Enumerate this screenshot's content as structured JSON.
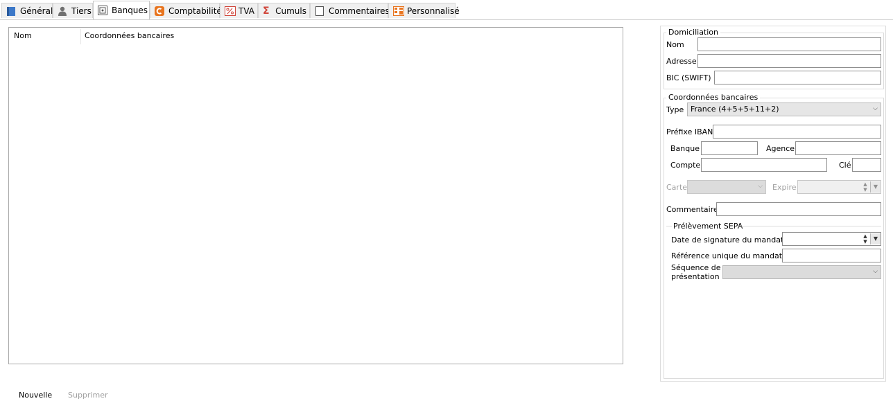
{
  "tabs": [
    {
      "label": "Général",
      "icon": "general-icon"
    },
    {
      "label": "Tiers",
      "icon": "person-icon"
    },
    {
      "label": "Banques",
      "icon": "bank-icon"
    },
    {
      "label": "Comptabilité",
      "icon": "accounting-icon"
    },
    {
      "label": "TVA",
      "icon": "percent-icon"
    },
    {
      "label": "Cumuls",
      "icon": "sigma-icon"
    },
    {
      "label": "Commentaires",
      "icon": "note-icon"
    },
    {
      "label": "Personnalisé",
      "icon": "custom-icon"
    }
  ],
  "list": {
    "columns": [
      "Nom",
      "Coordonnées bancaires"
    ]
  },
  "domiciliation": {
    "title": "Domiciliation",
    "nom_label": "Nom",
    "adresse_label": "Adresse",
    "bic_label": "BIC (SWIFT)",
    "nom_value": "",
    "adresse_value": "",
    "bic_value": ""
  },
  "coordonnees": {
    "title": "Coordonnées bancaires",
    "type_label": "Type",
    "type_value": "France (4+5+5+11+2)",
    "iban_label": "Préfixe IBAN",
    "banque_label": "Banque",
    "agence_label": "Agence",
    "compte_label": "Compte",
    "cle_label": "Clé",
    "carte_label": "Carte",
    "expire_label": "Expire",
    "commentaire_label": "Commentaire"
  },
  "sepa": {
    "title": "Prélèvement SEPA",
    "date_label": "Date de signature du mandat",
    "ref_label": "Référence unique du mandat",
    "seq_label_1": "Séquence de",
    "seq_label_2": "présentation"
  },
  "actions": {
    "new_label": "Nouvelle",
    "delete_label": "Supprimer"
  },
  "colors": {
    "accent_blue": "#3c78c8",
    "accent_orange": "#e8741e",
    "disabled_text": "#a0a0a0"
  }
}
